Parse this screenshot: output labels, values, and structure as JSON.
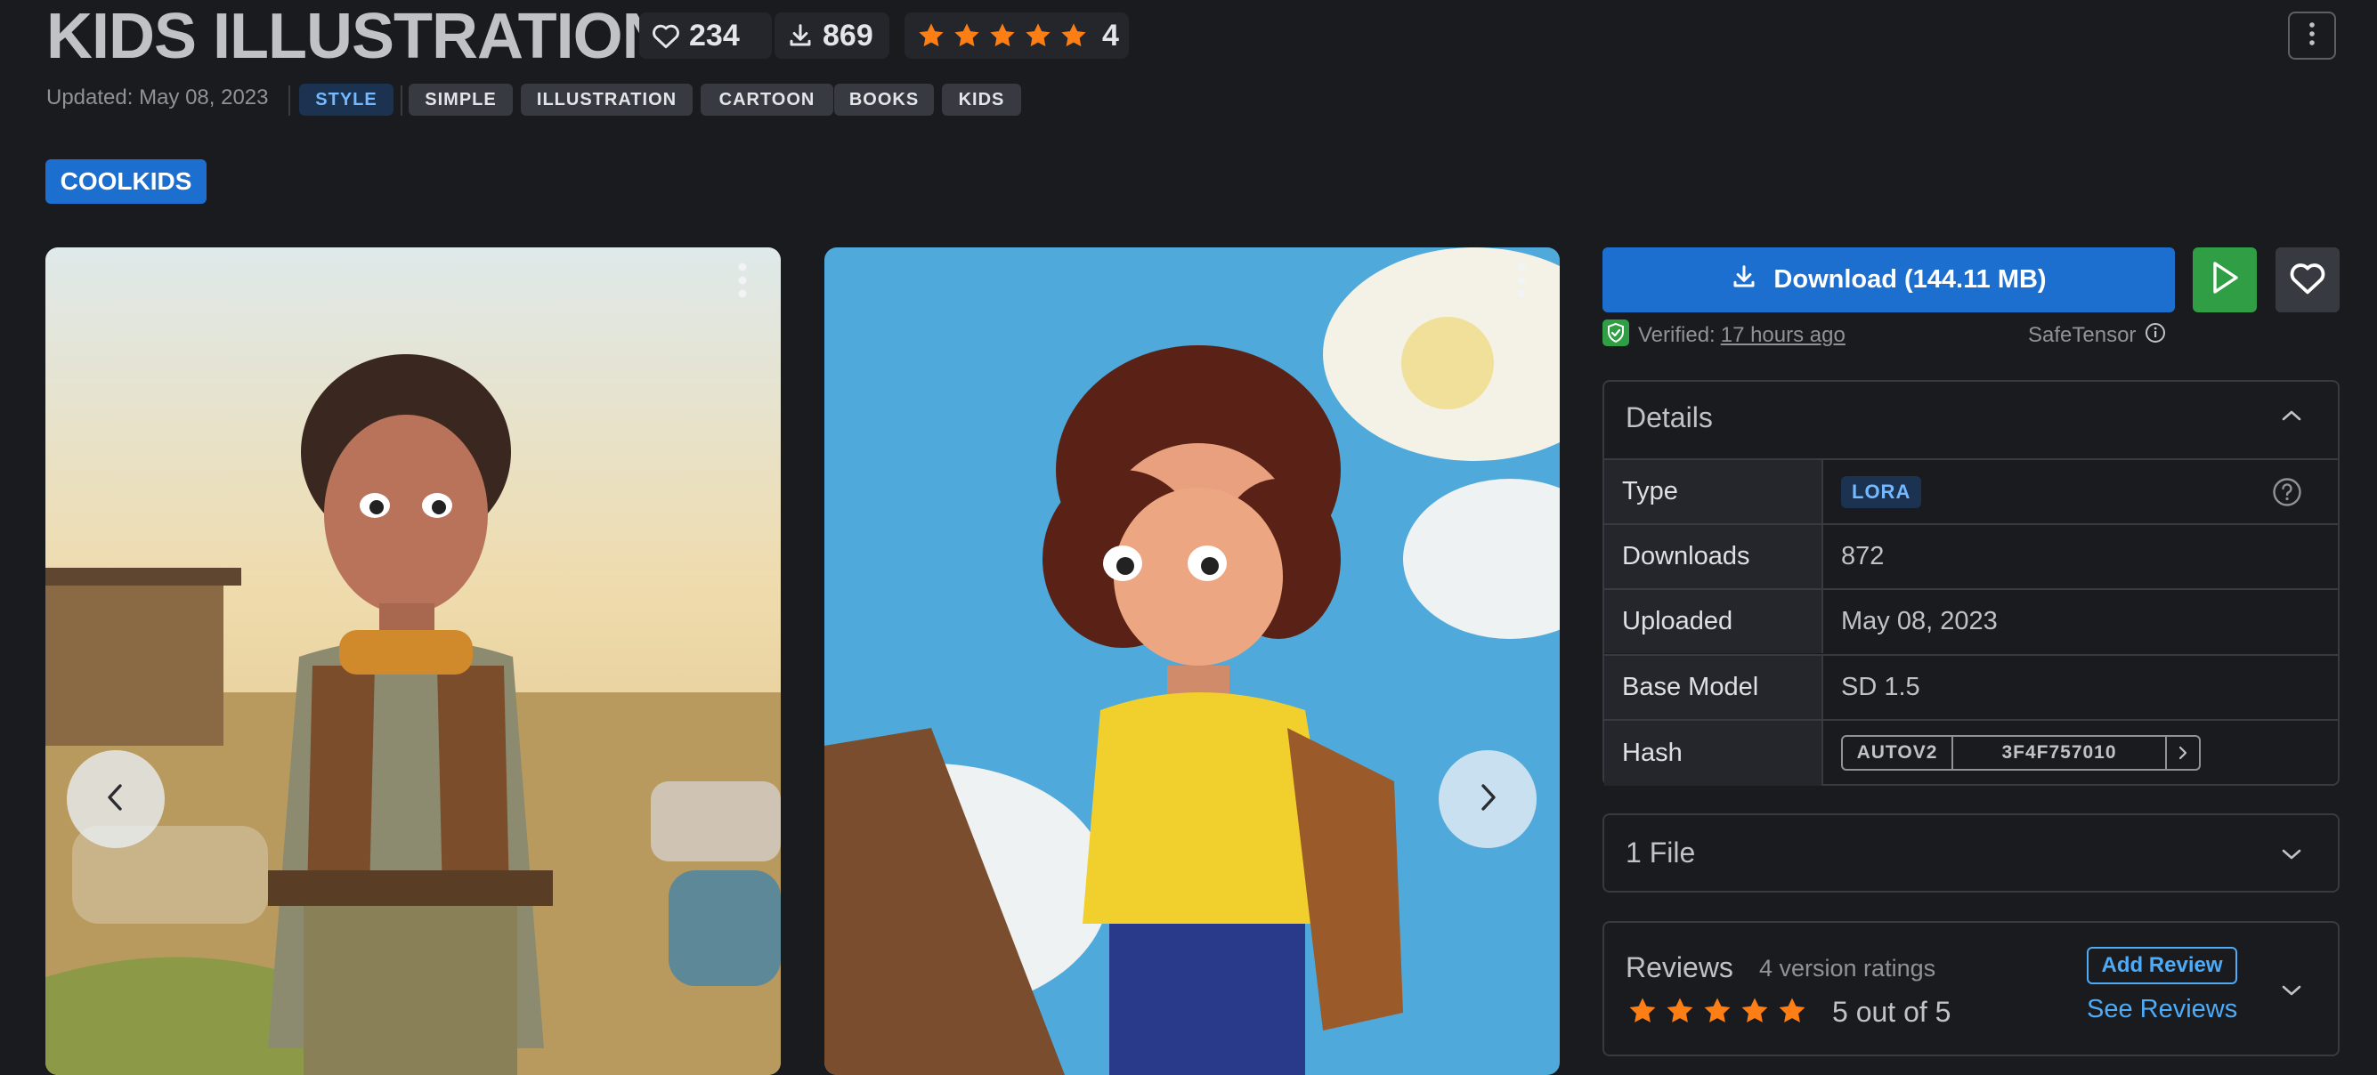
{
  "header": {
    "title": "KIDS ILLUSTRATION",
    "likes": "234",
    "downloads": "869",
    "rating_count": "4",
    "updated": "Updated: May 08, 2023",
    "tags": [
      "STYLE",
      "SIMPLE",
      "ILLUSTRATION",
      "CARTOON",
      "BOOKS",
      "KIDS"
    ],
    "trigger_word": "COOLKIDS"
  },
  "sidebar": {
    "download_label": "Download (144.11 MB)",
    "verified_prefix": "Verified:",
    "verified_time": "17 hours ago",
    "safetensor": "SafeTensor",
    "details": {
      "title": "Details",
      "rows": [
        {
          "key": "Type",
          "value": "LORA"
        },
        {
          "key": "Downloads",
          "value": "872"
        },
        {
          "key": "Uploaded",
          "value": "May 08, 2023"
        },
        {
          "key": "Base Model",
          "value": "SD 1.5"
        },
        {
          "key": "Hash",
          "value": ""
        }
      ],
      "hash_type": "AUTOV2",
      "hash_value": "3F4F757010"
    },
    "files_title": "1 File",
    "reviews": {
      "title": "Reviews",
      "count": "4 version ratings",
      "score": "5 out of 5",
      "add_label": "Add Review",
      "see_label": "See Reviews"
    }
  },
  "colors": {
    "background": "#1a1b1e",
    "accent_blue": "#1c6fce",
    "star": "#fd7e14",
    "green": "#2f9e44"
  },
  "icons": [
    "heart-icon",
    "download-icon",
    "star-icon",
    "dots-vertical-icon",
    "play-icon",
    "shield-check-icon",
    "info-icon",
    "chevron-up-icon",
    "chevron-down-icon",
    "chevron-left-icon",
    "chevron-right-icon",
    "help-icon"
  ]
}
